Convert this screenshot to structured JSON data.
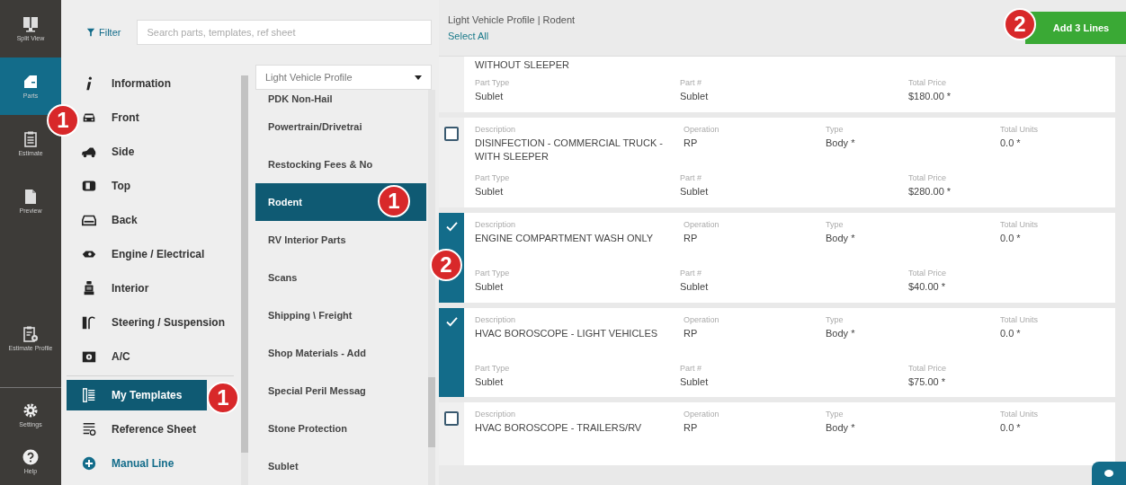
{
  "rail": [
    {
      "label": "Split View",
      "kind": "split",
      "selected": false
    },
    {
      "label": "Parts",
      "kind": "door",
      "selected": true,
      "callout": "1"
    },
    {
      "label": "Estimate",
      "kind": "clipboard",
      "selected": false
    },
    {
      "label": "Preview",
      "kind": "document",
      "selected": false
    },
    {
      "label": "Estimate Profile",
      "kind": "clipboard-gear",
      "selected": false
    }
  ],
  "rail_bottom": [
    {
      "label": "Settings",
      "kind": "gear"
    },
    {
      "label": "Help",
      "kind": "help"
    }
  ],
  "filter_button": "Filter",
  "search": {
    "placeholder": "Search parts, templates, ref sheet"
  },
  "categories": [
    {
      "label": "Information",
      "kind": "info",
      "selected": false
    },
    {
      "label": "Front",
      "kind": "front",
      "selected": false
    },
    {
      "label": "Side",
      "kind": "side",
      "selected": false
    },
    {
      "label": "Top",
      "kind": "top",
      "selected": false
    },
    {
      "label": "Back",
      "kind": "back",
      "selected": false
    },
    {
      "label": "Engine / Electrical",
      "kind": "engine",
      "selected": false
    },
    {
      "label": "Interior",
      "kind": "seat",
      "selected": false
    },
    {
      "label": "Steering / Suspension",
      "kind": "steering",
      "selected": false
    },
    {
      "label": "A/C",
      "kind": "ac",
      "selected": false
    }
  ],
  "tools": [
    {
      "label": "My Templates",
      "kind": "templates",
      "selected": true,
      "callout": "1"
    },
    {
      "label": "Reference Sheet",
      "kind": "reference",
      "selected": false
    },
    {
      "label": "Manual Line",
      "kind": "add",
      "selected": false
    }
  ],
  "profile_dropdown": "Light Vehicle Profile",
  "templates": [
    {
      "label": "PDK Non-Hail",
      "selected": false
    },
    {
      "label": "Powertrain/Drivetrai",
      "selected": false
    },
    {
      "label": "Restocking Fees & No",
      "selected": false
    },
    {
      "label": "Rodent",
      "selected": true,
      "callout": "1"
    },
    {
      "label": "RV Interior Parts",
      "selected": false
    },
    {
      "label": "Scans",
      "selected": false
    },
    {
      "label": "Shipping \\ Freight",
      "selected": false
    },
    {
      "label": "Shop Materials - Add",
      "selected": false
    },
    {
      "label": "Special Peril Messag",
      "selected": false
    },
    {
      "label": "Stone Protection",
      "selected": false
    },
    {
      "label": "Sublet",
      "selected": false
    }
  ],
  "breadcrumb": "Light Vehicle Profile | Rodent",
  "select_all": "Select All",
  "add_button": {
    "label": "Add 3 Lines",
    "callout": "2"
  },
  "lines": [
    {
      "top": [
        {
          "value": "WITHOUT SLEEPER"
        }
      ],
      "bottom": [
        {
          "label": "Part Type",
          "value": "Sublet"
        },
        {
          "label": "Part #",
          "value": "Sublet"
        },
        {
          "label": "Total Price",
          "value": "$180.00 *"
        }
      ]
    },
    {
      "checked": false,
      "top": [
        {
          "label": "Description",
          "value": "DISINFECTION - COMMERCIAL TRUCK - WITH SLEEPER"
        },
        {
          "label": "Operation",
          "value": "RP"
        },
        {
          "label": "Type",
          "value": "Body *"
        },
        {
          "label": "Total Units",
          "value": "0.0 *"
        }
      ],
      "bottom": [
        {
          "label": "Part Type",
          "value": "Sublet"
        },
        {
          "label": "Part #",
          "value": "Sublet"
        },
        {
          "label": "Total Price",
          "value": "$280.00 *"
        }
      ]
    },
    {
      "checked": true,
      "callout": "2",
      "top": [
        {
          "label": "Description",
          "value": "ENGINE COMPARTMENT WASH ONLY"
        },
        {
          "label": "Operation",
          "value": "RP"
        },
        {
          "label": "Type",
          "value": "Body *"
        },
        {
          "label": "Total Units",
          "value": "0.0 *"
        }
      ],
      "bottom": [
        {
          "label": "Part Type",
          "value": "Sublet"
        },
        {
          "label": "Part #",
          "value": "Sublet"
        },
        {
          "label": "Total Price",
          "value": "$40.00 *"
        }
      ]
    },
    {
      "checked": true,
      "top": [
        {
          "label": "Description",
          "value": "HVAC BOROSCOPE - LIGHT VEHICLES"
        },
        {
          "label": "Operation",
          "value": "RP"
        },
        {
          "label": "Type",
          "value": "Body *"
        },
        {
          "label": "Total Units",
          "value": "0.0 *"
        }
      ],
      "bottom": [
        {
          "label": "Part Type",
          "value": "Sublet"
        },
        {
          "label": "Part #",
          "value": "Sublet"
        },
        {
          "label": "Total Price",
          "value": "$75.00 *"
        }
      ]
    },
    {
      "checked": false,
      "top": [
        {
          "label": "Description",
          "value": "HVAC BOROSCOPE - TRAILERS/RV"
        },
        {
          "label": "Operation",
          "value": "RP"
        },
        {
          "label": "Type",
          "value": "Body *"
        },
        {
          "label": "Total Units",
          "value": "0.0 *"
        }
      ]
    }
  ]
}
